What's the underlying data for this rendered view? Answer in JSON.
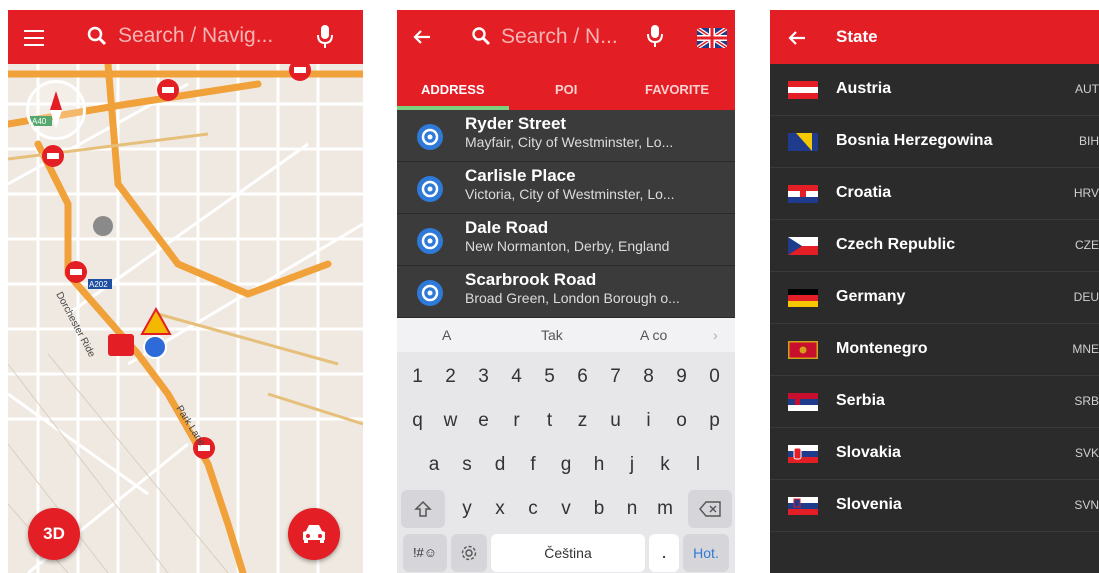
{
  "colors": {
    "accent": "#e31e24",
    "tab_indicator": "#7bd17e",
    "list_bg": "#2b2b2b"
  },
  "map_screen": {
    "menu_icon": "hamburger-icon",
    "search_placeholder": "Search / Navig...",
    "mic_icon": "microphone-icon",
    "road_labels": [
      "A40",
      "A202",
      "Dorchester Ride",
      "Park Lane"
    ],
    "btn_3d": "3D",
    "car_icon": "car-icon"
  },
  "search_screen": {
    "search_placeholder": "Search / N...",
    "tabs": [
      "ADDRESS",
      "POI",
      "FAVORITE"
    ],
    "results": [
      {
        "title": "Ryder Street",
        "subtitle": "Mayfair, City of Westminster, Lo..."
      },
      {
        "title": "Carlisle Place",
        "subtitle": "Victoria, City of Westminster, Lo..."
      },
      {
        "title": "Dale Road",
        "subtitle": "New Normanton, Derby, England"
      },
      {
        "title": "Scarbrook Road",
        "subtitle": "Broad Green, London Borough o..."
      }
    ],
    "suggestions": [
      "A",
      "Tak",
      "A co"
    ],
    "keyboard": {
      "row1": [
        "1",
        "2",
        "3",
        "4",
        "5",
        "6",
        "7",
        "8",
        "9",
        "0"
      ],
      "row2": [
        "q",
        "w",
        "e",
        "r",
        "t",
        "z",
        "u",
        "i",
        "o",
        "p"
      ],
      "row3": [
        "a",
        "s",
        "d",
        "f",
        "g",
        "h",
        "j",
        "k",
        "l"
      ],
      "row4": [
        "y",
        "x",
        "c",
        "v",
        "b",
        "n",
        "m"
      ],
      "sym_key": "!#☺",
      "space_label": "Čeština",
      "period": ".",
      "action_key": "Hot."
    }
  },
  "state_screen": {
    "title": "State",
    "states": [
      {
        "name": "Austria",
        "code": "AUT"
      },
      {
        "name": "Bosnia Herzegowina",
        "code": "BIH"
      },
      {
        "name": "Croatia",
        "code": "HRV"
      },
      {
        "name": "Czech Republic",
        "code": "CZE"
      },
      {
        "name": "Germany",
        "code": "DEU"
      },
      {
        "name": "Montenegro",
        "code": "MNE"
      },
      {
        "name": "Serbia",
        "code": "SRB"
      },
      {
        "name": "Slovakia",
        "code": "SVK"
      },
      {
        "name": "Slovenia",
        "code": "SVN"
      }
    ]
  }
}
